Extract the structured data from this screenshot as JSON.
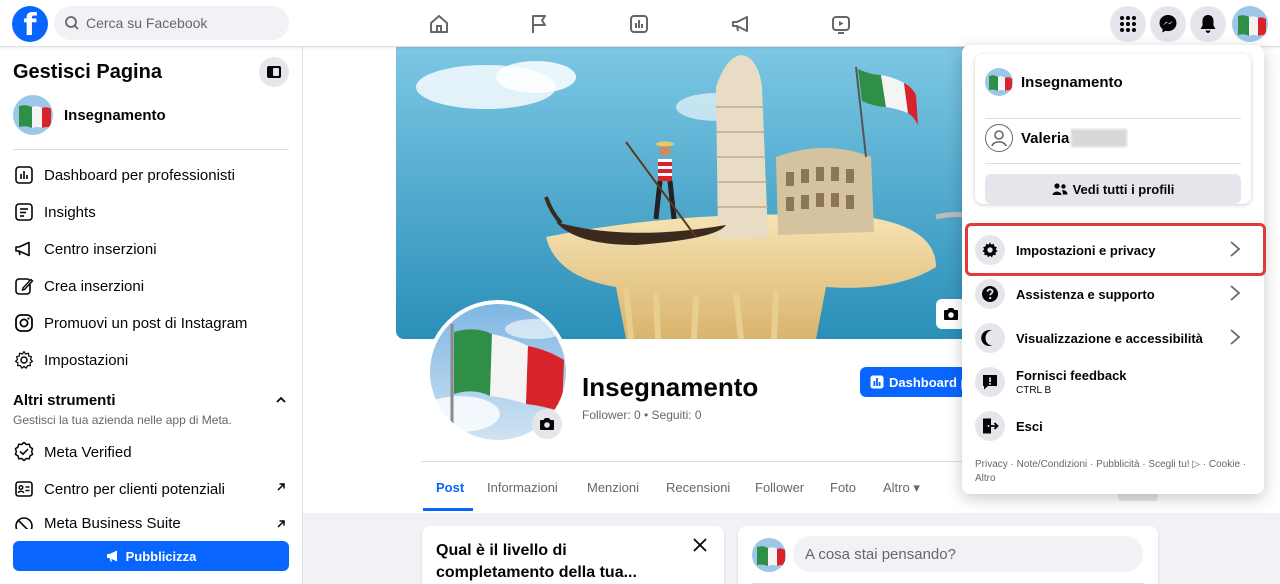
{
  "topbar": {
    "logo": "f",
    "search_placeholder": "Cerca su Facebook",
    "nav_icons": [
      "home-icon",
      "flag-icon",
      "dashboard-icon",
      "megaphone-icon",
      "video-icon"
    ],
    "right_icons": [
      "apps-grid-icon",
      "messenger-icon",
      "bell-icon"
    ]
  },
  "sidebar": {
    "title": "Gestisci Pagina",
    "page_name": "Insegnamento",
    "items": [
      {
        "label": "Dashboard per professionisti",
        "icon": "dashboard-icon"
      },
      {
        "label": "Insights",
        "icon": "insights-icon"
      },
      {
        "label": "Centro inserzioni",
        "icon": "megaphone-icon"
      },
      {
        "label": "Crea inserzioni",
        "icon": "edit-icon"
      },
      {
        "label": "Promuovi un post di Instagram",
        "icon": "instagram-icon"
      },
      {
        "label": "Impostazioni",
        "icon": "gear-icon"
      }
    ],
    "other_tools_title": "Altri strumenti",
    "other_tools_sub": "Gestisci la tua azienda nelle app di Meta.",
    "tools": [
      {
        "label": "Meta Verified",
        "icon": "verified-icon"
      },
      {
        "label": "Centro per clienti potenziali",
        "icon": "leads-icon"
      },
      {
        "label": "Meta Business Suite",
        "icon": "business-suite-icon"
      }
    ],
    "promote_label": "Pubblicizza"
  },
  "page": {
    "name": "Insegnamento",
    "stats": "Follower: 0 • Seguiti: 0",
    "dashboard_button": "Dashboard p",
    "tabs": [
      "Post",
      "Informazioni",
      "Menzioni",
      "Recensioni",
      "Follower",
      "Foto",
      "Altro ▾"
    ],
    "active_tab": "Post",
    "completion_card_title": "Qual è il livello di completamento della tua...",
    "composer_placeholder": "A cosa stai pensando?"
  },
  "dropdown": {
    "profiles": [
      {
        "name": "Insegnamento"
      },
      {
        "name": "Valeria"
      }
    ],
    "see_all_label": "Vedi tutti i profili",
    "menu": [
      {
        "label": "Impostazioni e privacy",
        "icon": "gear-icon",
        "chevron": true
      },
      {
        "label": "Assistenza e supporto",
        "icon": "help-icon",
        "chevron": true
      },
      {
        "label": "Visualizzazione e accessibilità",
        "icon": "moon-icon",
        "chevron": true
      },
      {
        "label": "Fornisci feedback",
        "sub": "CTRL B",
        "icon": "feedback-icon",
        "chevron": false
      },
      {
        "label": "Esci",
        "icon": "logout-icon",
        "chevron": false
      }
    ],
    "footer": "Privacy · Note/Condizioni · Pubblicità · Scegli tu! ▷ · Cookie · Altro"
  },
  "colors": {
    "brand": "#0866ff",
    "highlight": "#e03b3b"
  }
}
